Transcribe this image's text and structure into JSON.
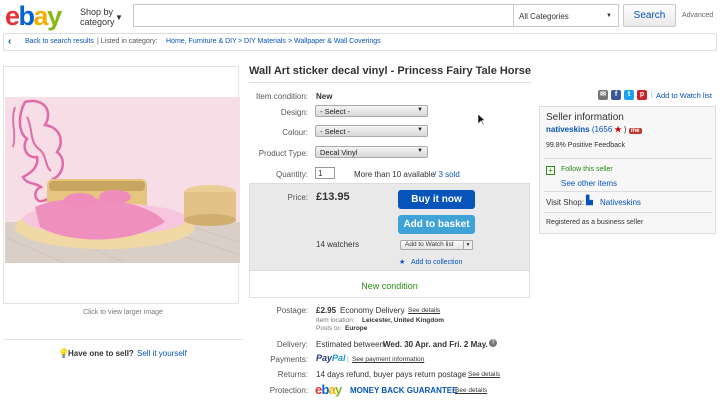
{
  "header": {
    "logo": {
      "e": "e",
      "b": "b",
      "a": "a",
      "y": "y"
    },
    "shop_by_line1": "Shop by",
    "shop_by_line2": "category",
    "search_placeholder": "",
    "category": "All Categories",
    "search_button": "Search",
    "advanced": "Advanced"
  },
  "breadcrumb": {
    "back": "Back to search results",
    "listed_in": "| Listed in category:",
    "crumbs": [
      "Home, Furniture & DIY",
      "> DIY Materials",
      "> Wallpaper & Wall Coverings"
    ]
  },
  "image": {
    "click_larger": "Click to view larger image",
    "have_one": "Have one to sell?",
    "sell_it": "Sell it yourself"
  },
  "item": {
    "title": "Wall Art sticker decal vinyl - Princess Fairy Tale Horse",
    "condition_label": "Item condition:",
    "condition_value": "New",
    "design_label": "Design:",
    "design_value": "- Select -",
    "colour_label": "Colour:",
    "colour_value": "- Select -",
    "type_label": "Product Type:",
    "type_value": "Decal Vinyl",
    "quantity_label": "Quantity:",
    "quantity_value": "1",
    "available": "More than 10 available",
    "sold": "/ 3 sold",
    "price_label": "Price:",
    "price_value": "£13.95",
    "buy_now": "Buy it now",
    "add_basket": "Add to basket",
    "watchers": "14 watchers",
    "add_watch": "Add to Watch list",
    "add_collection": "Add to collection",
    "new_condition": "New condition"
  },
  "shipping": {
    "postage_label": "Postage:",
    "postage_price": "£2.95",
    "postage_service": "Economy Delivery",
    "see_details": "See details",
    "item_location_label": "Item location:",
    "item_location": "Leicester, United Kingdom",
    "posts_to_label": "Posts to:",
    "posts_to": "Europe",
    "delivery_label": "Delivery:",
    "delivery_prefix": "Estimated between",
    "delivery_dates": "Wed. 30 Apr. and Fri. 2 May.",
    "payments_label": "Payments:",
    "paypal_1": "Pay",
    "paypal_2": "Pal",
    "see_payment": "See payment information",
    "returns_label": "Returns:",
    "returns_text": "14 days refund, buyer pays return postage",
    "protection_label": "Protection:",
    "money_back": "MONEY BACK GUARANTEE"
  },
  "seller": {
    "add_watch_link": "Add to Watch list",
    "title": "Seller information",
    "name": "nativeskins",
    "score": "(1656",
    "close_paren": ")",
    "me": "me",
    "feedback": "99.8% Positive Feedback",
    "follow": "Follow this seller",
    "see_other": "See other items",
    "visit_shop": "Visit Shop:",
    "shop_name": "Nativeskins",
    "registered": "Registered as a business seller"
  }
}
